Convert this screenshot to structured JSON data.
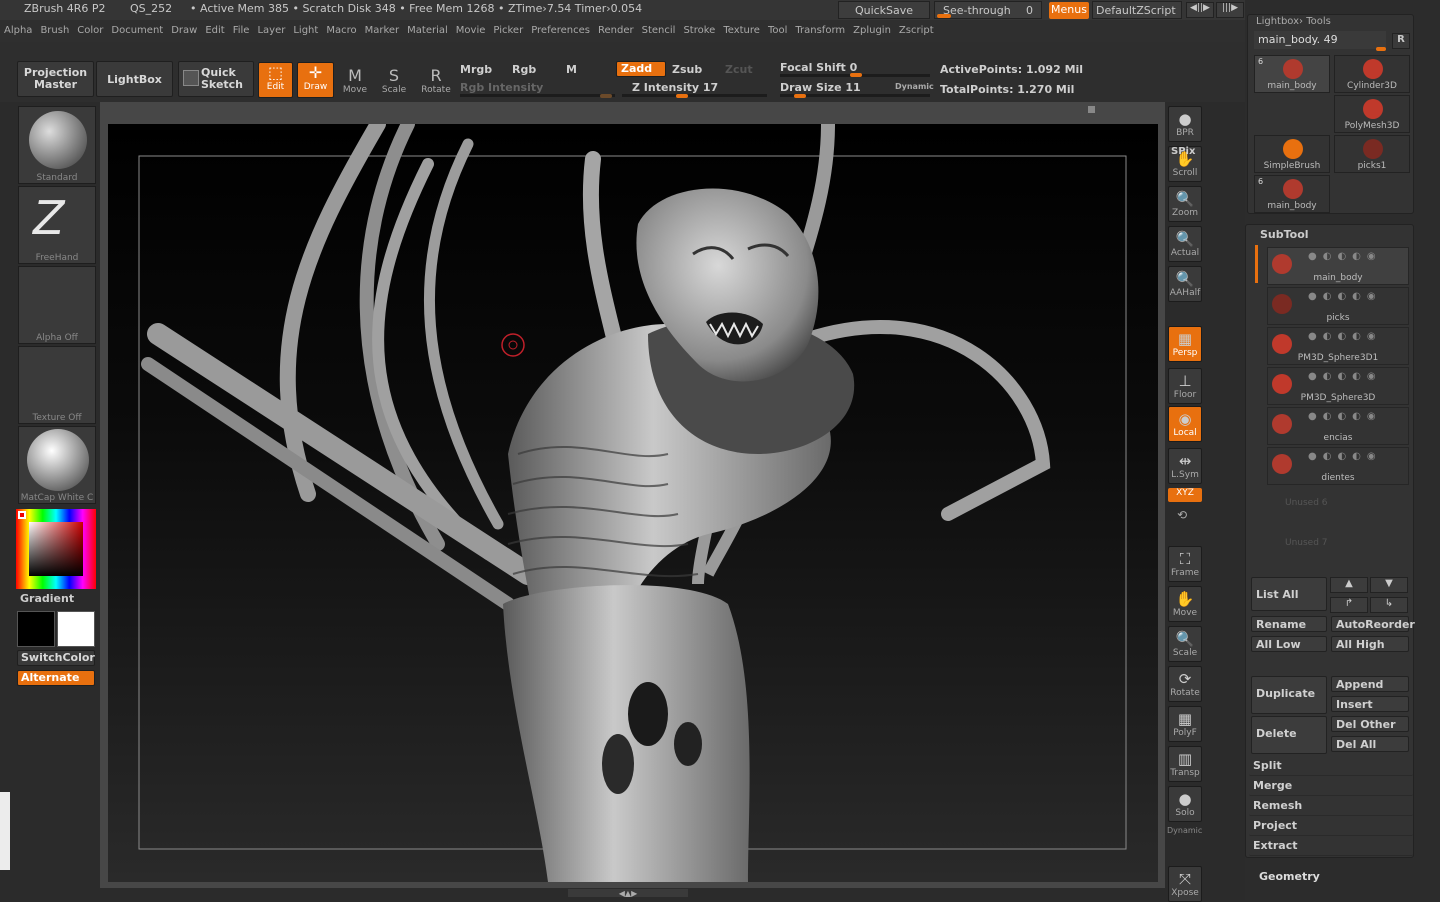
{
  "title_bar": {
    "app": "ZBrush 4R6 P2",
    "qs": "QS_252",
    "stats": "• Active Mem 385 • Scratch Disk 348 • Free Mem 1268 • ZTime›7.54 Timer›0.054",
    "quicksave": "QuickSave",
    "seethrough": "See-through",
    "seethrough_val": "0",
    "menus": "Menus",
    "script": "DefaultZScript"
  },
  "menus": [
    "Alpha",
    "Brush",
    "Color",
    "Document",
    "Draw",
    "Edit",
    "File",
    "Layer",
    "Light",
    "Macro",
    "Marker",
    "Material",
    "Movie",
    "Picker",
    "Preferences",
    "Render",
    "Stencil",
    "Stroke",
    "Texture",
    "Tool",
    "Transform",
    "Zplugin",
    "Zscript"
  ],
  "toolbar": {
    "projection_master_1": "Projection",
    "projection_master_2": "Master",
    "lightbox": "LightBox",
    "quick_sketch_1": "Quick",
    "quick_sketch_2": "Sketch",
    "edit": "Edit",
    "draw": "Draw",
    "move": "Move",
    "scale": "Scale",
    "rotate": "Rotate",
    "mrgb": "Mrgb",
    "rgb": "Rgb",
    "m": "M",
    "rgb_intensity": "Rgb Intensity",
    "zadd": "Zadd",
    "zsub": "Zsub",
    "zcut": "Zcut",
    "z_intensity": "Z Intensity 17",
    "focal_shift": "Focal Shift 0",
    "draw_size": "Draw Size 11",
    "dynamic": "Dynamic",
    "active_points": "ActivePoints: 1.092 Mil",
    "total_points": "TotalPoints: 1.270 Mil"
  },
  "left": {
    "standard": "Standard",
    "freehand": "FreeHand",
    "alpha_off": "Alpha Off",
    "texture_off": "Texture Off",
    "matcap": "MatCap White C",
    "gradient": "Gradient",
    "switchcolor": "SwitchColor",
    "alternate": "Alternate"
  },
  "right_shelf": [
    {
      "label": "BPR",
      "glyph": "●"
    },
    {
      "label": "Scroll",
      "glyph": "✋"
    },
    {
      "label": "Zoom",
      "glyph": "🔍"
    },
    {
      "label": "Actual",
      "glyph": "🔍"
    },
    {
      "label": "AAHalf",
      "glyph": "🔍"
    },
    {
      "label": "Persp",
      "glyph": "▦"
    },
    {
      "label": "Floor",
      "glyph": "⊥"
    },
    {
      "label": "Local",
      "glyph": "◉"
    },
    {
      "label": "L.Sym",
      "glyph": "⇹"
    },
    {
      "label": "Frame",
      "glyph": "⛶"
    },
    {
      "label": "Move",
      "glyph": "✋"
    },
    {
      "label": "Scale",
      "glyph": "🔍"
    },
    {
      "label": "Rotate",
      "glyph": "⟳"
    },
    {
      "label": "PolyF",
      "glyph": "▦"
    },
    {
      "label": "Transp",
      "glyph": "▥"
    },
    {
      "label": "Solo",
      "glyph": "●"
    },
    {
      "label": "Xpose",
      "glyph": "⤧"
    }
  ],
  "right_extra": {
    "spix": "SPix",
    "xyz": "XYZ",
    "dynamic": "Dynamic"
  },
  "tool": {
    "header": "Lightbox› Tools",
    "current": "main_body. 49",
    "r": "R",
    "items": [
      {
        "name": "main_body",
        "count": "6"
      },
      {
        "name": "Cylinder3D",
        "count": ""
      },
      {
        "name": "PolyMesh3D",
        "count": ""
      },
      {
        "name": "SimpleBrush",
        "count": ""
      },
      {
        "name": "picks1",
        "count": ""
      },
      {
        "name": "main_body",
        "count": "6"
      }
    ]
  },
  "subtool": {
    "header": "SubTool",
    "items": [
      "main_body",
      "picks",
      "PM3D_Sphere3D1",
      "PM3D_Sphere3D",
      "encias",
      "dientes"
    ],
    "unused": [
      "Unused 6",
      "Unused 7"
    ],
    "list_all": "List All",
    "rename": "Rename",
    "autoreorder": "AutoReorder",
    "all_low": "All Low",
    "all_high": "All High",
    "duplicate": "Duplicate",
    "append": "Append",
    "insert": "Insert",
    "delete": "Delete",
    "del_other": "Del Other",
    "del_all": "Del All",
    "split": "Split",
    "merge": "Merge",
    "remesh": "Remesh",
    "project": "Project",
    "extract": "Extract",
    "geometry": "Geometry"
  },
  "colors": {
    "accent": "#e8700f",
    "panel": "#333333",
    "bg": "#2b2b2b"
  }
}
